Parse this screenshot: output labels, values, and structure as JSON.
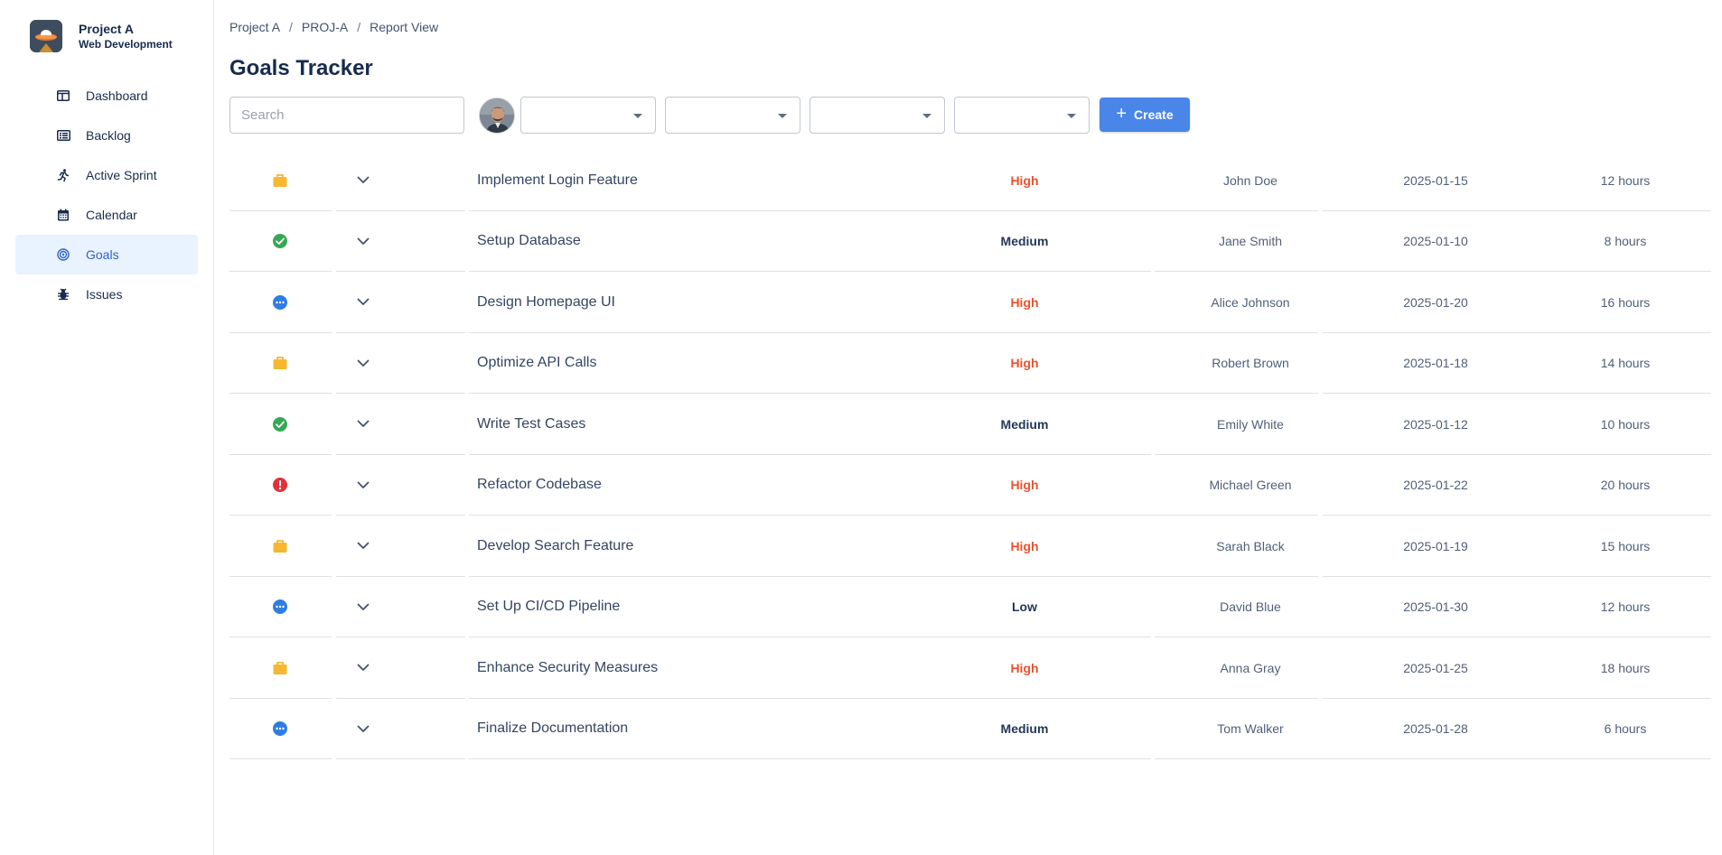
{
  "project": {
    "name": "Project A",
    "subtitle": "Web Development"
  },
  "nav": [
    {
      "label": "Dashboard",
      "icon": "dashboard-icon",
      "active": false
    },
    {
      "label": "Backlog",
      "icon": "backlog-icon",
      "active": false
    },
    {
      "label": "Active Sprint",
      "icon": "running-person-icon",
      "active": false
    },
    {
      "label": "Calendar",
      "icon": "calendar-icon",
      "active": false
    },
    {
      "label": "Goals",
      "icon": "target-icon",
      "active": true
    },
    {
      "label": "Issues",
      "icon": "bug-icon",
      "active": false
    }
  ],
  "breadcrumb": {
    "items": [
      "Project A",
      "PROJ-A",
      "Report View"
    ],
    "separator": "/"
  },
  "page": {
    "title": "Goals Tracker"
  },
  "toolbar": {
    "search_placeholder": "Search",
    "create_label": "Create"
  },
  "colors": {
    "accent": "#4a86e8",
    "priority_high": "#e8522d",
    "priority_default": "#253858",
    "status_todo": "#f5b82e",
    "status_done": "#36a852",
    "status_in_progress": "#2f7de1",
    "status_blocked": "#e0323a"
  },
  "goals": [
    {
      "status": "todo",
      "title": "Implement Login Feature",
      "priority": "High",
      "assignee": "John Doe",
      "date": "2025-01-15",
      "hours": "12 hours"
    },
    {
      "status": "done",
      "title": "Setup Database",
      "priority": "Medium",
      "assignee": "Jane Smith",
      "date": "2025-01-10",
      "hours": "8 hours"
    },
    {
      "status": "in_progress",
      "title": "Design Homepage UI",
      "priority": "High",
      "assignee": "Alice Johnson",
      "date": "2025-01-20",
      "hours": "16 hours"
    },
    {
      "status": "todo",
      "title": "Optimize API Calls",
      "priority": "High",
      "assignee": "Robert Brown",
      "date": "2025-01-18",
      "hours": "14 hours"
    },
    {
      "status": "done",
      "title": "Write Test Cases",
      "priority": "Medium",
      "assignee": "Emily White",
      "date": "2025-01-12",
      "hours": "10 hours"
    },
    {
      "status": "blocked",
      "title": "Refactor Codebase",
      "priority": "High",
      "assignee": "Michael Green",
      "date": "2025-01-22",
      "hours": "20 hours"
    },
    {
      "status": "todo",
      "title": "Develop Search Feature",
      "priority": "High",
      "assignee": "Sarah Black",
      "date": "2025-01-19",
      "hours": "15 hours"
    },
    {
      "status": "in_progress",
      "title": "Set Up CI/CD Pipeline",
      "priority": "Low",
      "assignee": "David Blue",
      "date": "2025-01-30",
      "hours": "12 hours"
    },
    {
      "status": "todo",
      "title": "Enhance Security Measures",
      "priority": "High",
      "assignee": "Anna Gray",
      "date": "2025-01-25",
      "hours": "18 hours"
    },
    {
      "status": "in_progress",
      "title": "Finalize Documentation",
      "priority": "Medium",
      "assignee": "Tom Walker",
      "date": "2025-01-28",
      "hours": "6 hours"
    }
  ]
}
